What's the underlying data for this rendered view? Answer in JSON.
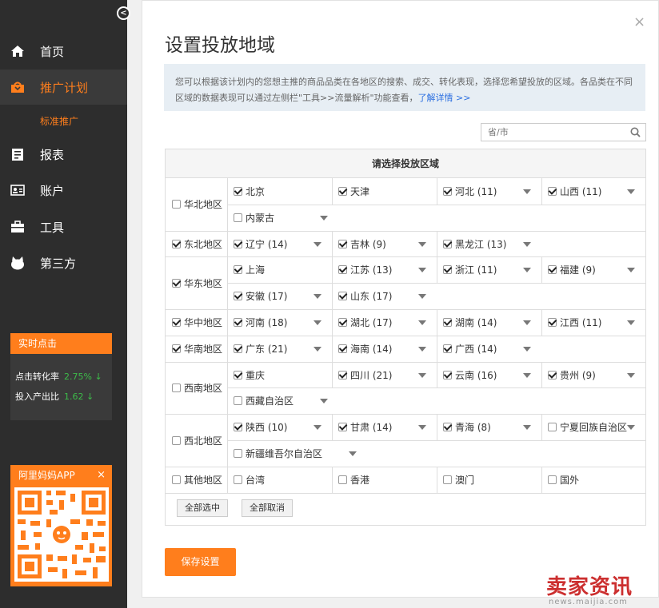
{
  "sidebar": {
    "collapse_icon": "chevron-left-icon",
    "items": [
      {
        "label": "首页",
        "icon": "home-icon"
      },
      {
        "label": "推广计划",
        "icon": "bag-icon"
      },
      {
        "label": "报表",
        "icon": "report-icon"
      },
      {
        "label": "账户",
        "icon": "account-icon"
      },
      {
        "label": "工具",
        "icon": "toolbox-icon"
      },
      {
        "label": "第三方",
        "icon": "cat-icon"
      }
    ],
    "sub_item": "标准推广",
    "realtime": {
      "title": "实时点击",
      "ctr_label": "点击转化率",
      "ctr_value": "2.75%",
      "roi_label": "投入产出比",
      "roi_value": "1.62",
      "trend": "↓"
    },
    "app": {
      "title": "阿里妈妈APP",
      "close": "×"
    }
  },
  "panel": {
    "close": "×",
    "title": "设置投放地域",
    "info_text": "您可以根据该计划内的您想主推的商品品类在各地区的搜索、成交、转化表现，选择您希望投放的区域。各品类在不同区域的数据表现可以通过左侧栏\"工具>>流量解析\"功能查看，",
    "info_link": "了解详情 >>",
    "search_placeholder": "省/市",
    "grid_header": "请选择投放区域",
    "regions": [
      {
        "name": "华北地区",
        "checked": false,
        "rows": [
          [
            {
              "n": "北京",
              "c": true,
              "d": false
            },
            {
              "n": "天津",
              "c": true,
              "d": false
            },
            {
              "n": "河北 (11)",
              "c": true,
              "d": true
            },
            {
              "n": "山西 (11)",
              "c": true,
              "d": true
            }
          ],
          [
            {
              "n": "内蒙古",
              "c": false,
              "d": true
            }
          ]
        ]
      },
      {
        "name": "东北地区",
        "checked": true,
        "rows": [
          [
            {
              "n": "辽宁 (14)",
              "c": true,
              "d": true
            },
            {
              "n": "吉林 (9)",
              "c": true,
              "d": true
            },
            {
              "n": "黑龙江 (13)",
              "c": true,
              "d": true
            }
          ]
        ]
      },
      {
        "name": "华东地区",
        "checked": true,
        "rows": [
          [
            {
              "n": "上海",
              "c": true,
              "d": false
            },
            {
              "n": "江苏 (13)",
              "c": true,
              "d": true
            },
            {
              "n": "浙江 (11)",
              "c": true,
              "d": true
            },
            {
              "n": "福建 (9)",
              "c": true,
              "d": true
            }
          ],
          [
            {
              "n": "安徽 (17)",
              "c": true,
              "d": true
            },
            {
              "n": "山东 (17)",
              "c": true,
              "d": true
            }
          ]
        ]
      },
      {
        "name": "华中地区",
        "checked": true,
        "rows": [
          [
            {
              "n": "河南 (18)",
              "c": true,
              "d": true
            },
            {
              "n": "湖北 (17)",
              "c": true,
              "d": true
            },
            {
              "n": "湖南 (14)",
              "c": true,
              "d": true
            },
            {
              "n": "江西 (11)",
              "c": true,
              "d": true
            }
          ]
        ]
      },
      {
        "name": "华南地区",
        "checked": true,
        "rows": [
          [
            {
              "n": "广东 (21)",
              "c": true,
              "d": true
            },
            {
              "n": "海南 (14)",
              "c": true,
              "d": true
            },
            {
              "n": "广西 (14)",
              "c": true,
              "d": true
            }
          ]
        ]
      },
      {
        "name": "西南地区",
        "checked": false,
        "rows": [
          [
            {
              "n": "重庆",
              "c": true,
              "d": false
            },
            {
              "n": "四川 (21)",
              "c": true,
              "d": true
            },
            {
              "n": "云南 (16)",
              "c": true,
              "d": true
            },
            {
              "n": "贵州 (9)",
              "c": true,
              "d": true
            }
          ],
          [
            {
              "n": "西藏自治区",
              "c": false,
              "d": true
            }
          ]
        ]
      },
      {
        "name": "西北地区",
        "checked": false,
        "rows": [
          [
            {
              "n": "陕西 (10)",
              "c": true,
              "d": true
            },
            {
              "n": "甘肃 (14)",
              "c": true,
              "d": true
            },
            {
              "n": "青海 (8)",
              "c": true,
              "d": true
            },
            {
              "n": "宁夏回族自治区",
              "c": false,
              "d": true
            }
          ],
          [
            {
              "n": "新疆维吾尔自治区",
              "c": false,
              "d": true
            }
          ]
        ]
      },
      {
        "name": "其他地区",
        "checked": false,
        "rows": [
          [
            {
              "n": "台湾",
              "c": false,
              "d": false
            },
            {
              "n": "香港",
              "c": false,
              "d": false
            },
            {
              "n": "澳门",
              "c": false,
              "d": false
            },
            {
              "n": "国外",
              "c": false,
              "d": false
            }
          ]
        ]
      }
    ],
    "select_all": "全部选中",
    "deselect_all": "全部取消",
    "save": "保存设置"
  },
  "watermark": {
    "cn": "卖家资讯",
    "url": "news.maijia.com"
  },
  "colors": {
    "accent": "#ff7e1c",
    "sidebar": "#2d2d2d",
    "link": "#2a6ee0",
    "positive": "#3dbb4a"
  }
}
